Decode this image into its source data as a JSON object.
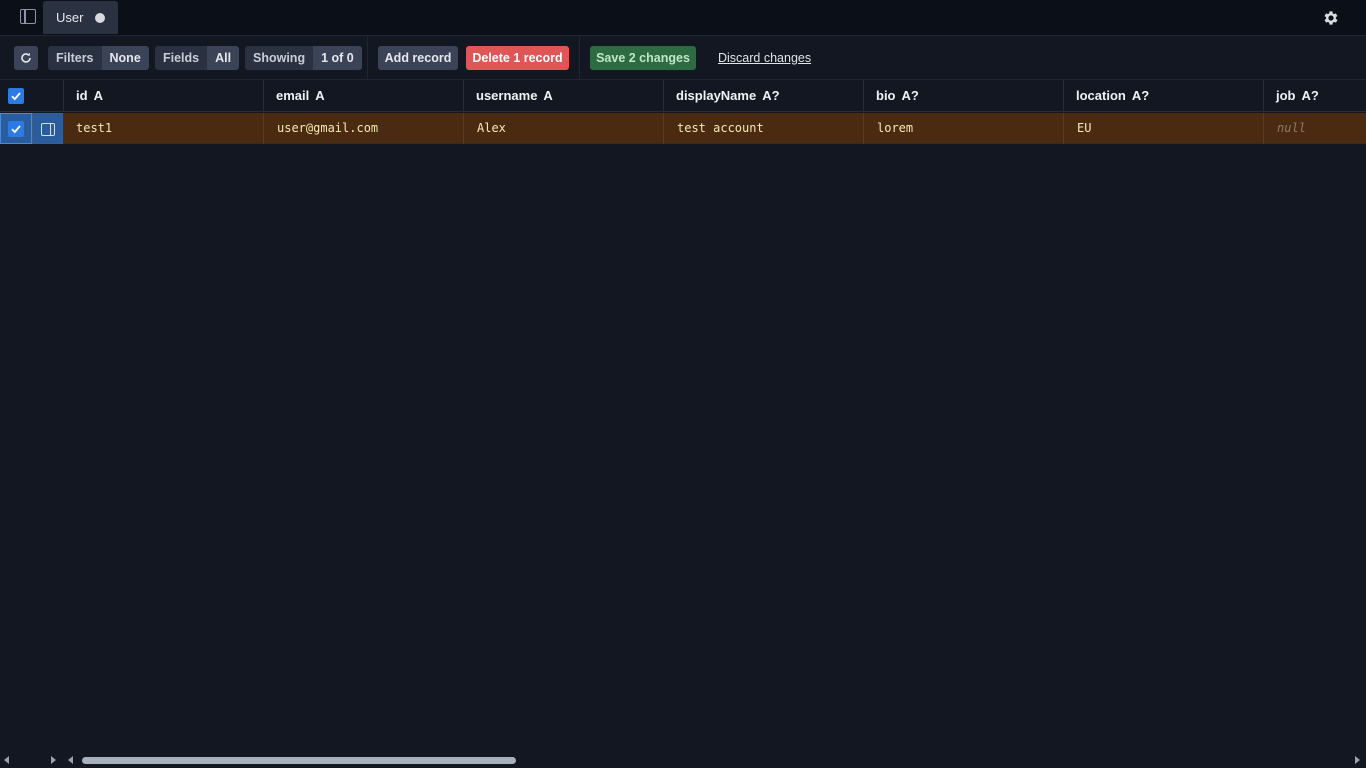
{
  "tabbar": {
    "tab_label": "User",
    "sidebar_icon": "sidebar-icon",
    "settings_icon": "gear-icon"
  },
  "toolbar": {
    "refresh_icon": "refresh-icon",
    "filters": {
      "label": "Filters",
      "value": "None"
    },
    "fields": {
      "label": "Fields",
      "value": "All"
    },
    "showing": {
      "label": "Showing",
      "value": "1 of 0"
    },
    "add_label": "Add record",
    "delete_label": "Delete 1 record",
    "save_label": "Save 2 changes",
    "discard_label": "Discard changes"
  },
  "grid": {
    "columns": [
      {
        "name": "id",
        "type": "A"
      },
      {
        "name": "email",
        "type": "A"
      },
      {
        "name": "username",
        "type": "A"
      },
      {
        "name": "displayName",
        "type": "A?"
      },
      {
        "name": "bio",
        "type": "A?"
      },
      {
        "name": "location",
        "type": "A?"
      },
      {
        "name": "job",
        "type": "A?"
      }
    ],
    "rows": [
      {
        "cells": [
          "test1",
          "user@gmail.com",
          "Alex",
          "test account",
          "lorem",
          "EU",
          "null"
        ]
      }
    ]
  },
  "colors": {
    "background": "#121722",
    "selected_row": "#4a2a10",
    "delete": "#e05656",
    "save": "#2e6b43",
    "accent": "#2c7be5"
  }
}
